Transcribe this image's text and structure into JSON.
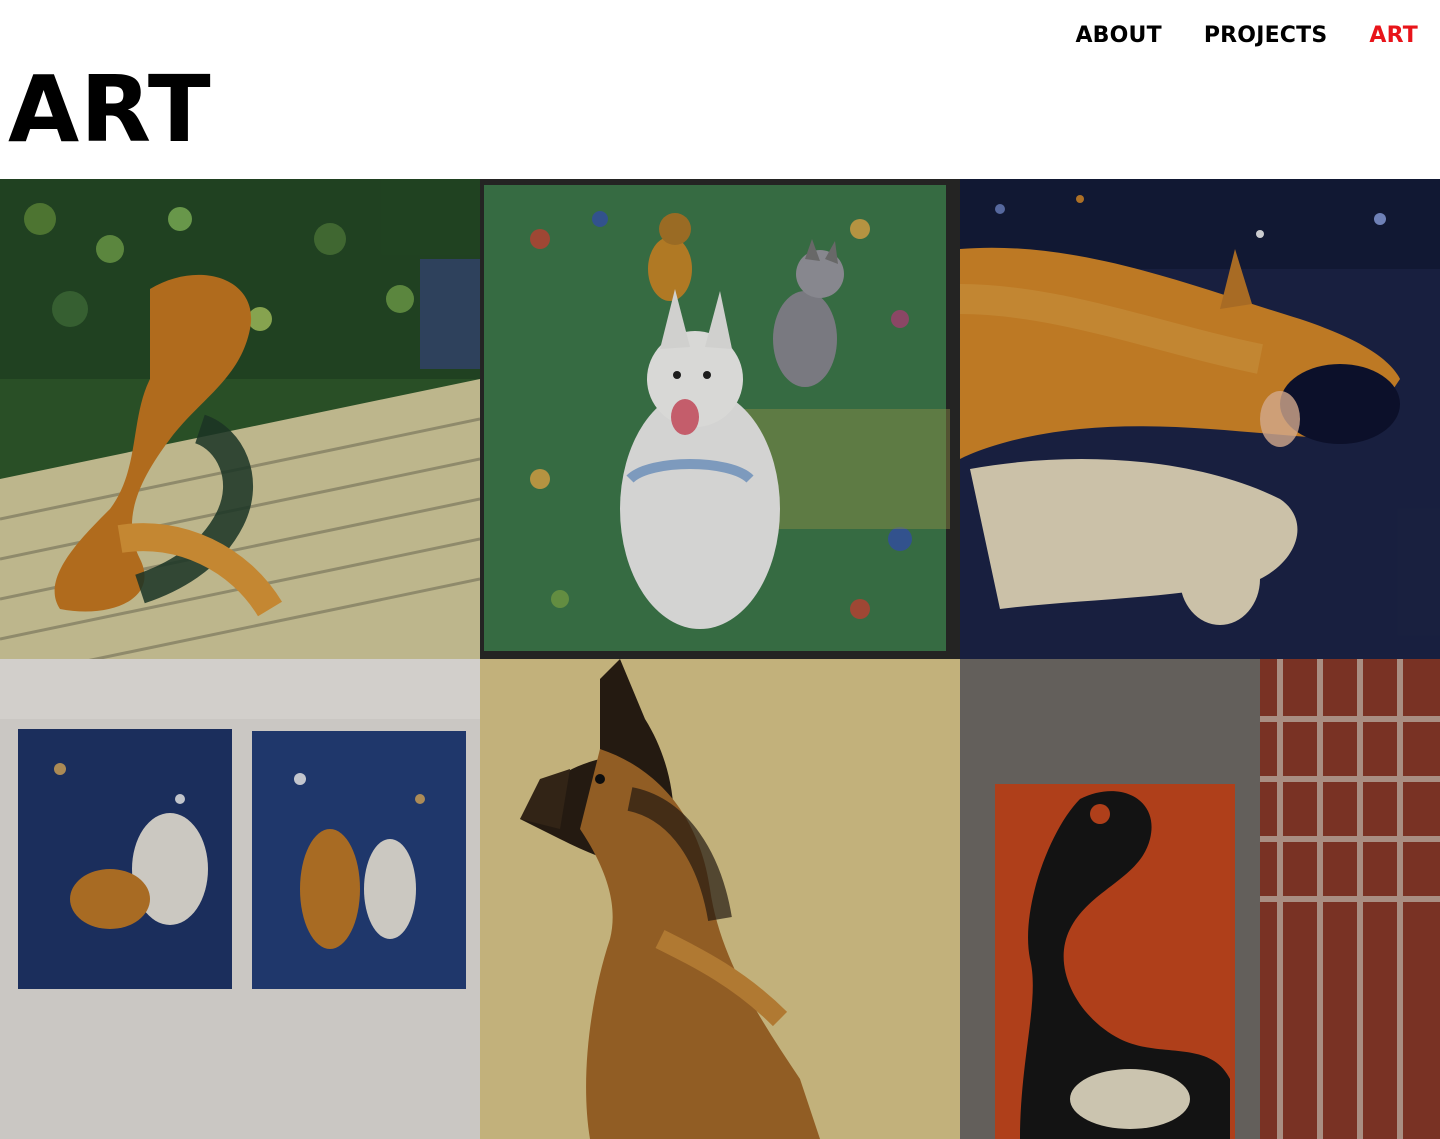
{
  "nav": {
    "items": [
      {
        "label": "ABOUT",
        "active": false
      },
      {
        "label": "PROJECTS",
        "active": false
      },
      {
        "label": "ART",
        "active": true
      }
    ],
    "active_color": "#e8141a"
  },
  "page": {
    "title": "ART"
  },
  "gallery": {
    "tiles": [
      {
        "subject": "painting-swimmers-on-dock",
        "palette": [
          "#2f5a2c",
          "#c97a22",
          "#d8d0a0",
          "#1e3b2a"
        ]
      },
      {
        "subject": "painting-three-german-shepherds-on-grass",
        "palette": [
          "#3e7a4c",
          "#f1f1ef",
          "#6f6f6f",
          "#2a2a28"
        ]
      },
      {
        "subject": "painting-dog-splashing-water",
        "palette": [
          "#1c2448",
          "#d88a2a",
          "#e8dcc0",
          "#0e1330"
        ]
      },
      {
        "subject": "photo-two-water-dog-paintings-on-wall",
        "palette": [
          "#e6e3de",
          "#1f3569",
          "#c07a28",
          "#ffffff"
        ]
      },
      {
        "subject": "painting-german-shepherd-profile",
        "palette": [
          "#d6c07a",
          "#a56a2a",
          "#2a1e14",
          "#e9d9a8"
        ]
      },
      {
        "subject": "photo-painting-and-plaid-shirt",
        "palette": [
          "#3a3633",
          "#c8481e",
          "#8a3a2a",
          "#d9d4cc"
        ]
      }
    ]
  }
}
